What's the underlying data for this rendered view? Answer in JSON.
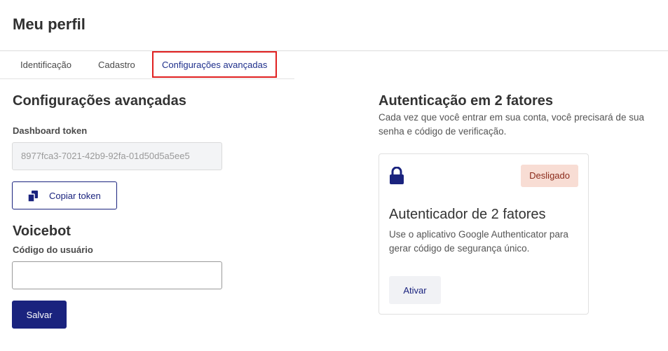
{
  "page": {
    "title": "Meu perfil"
  },
  "tabs": [
    {
      "label": "Identificação"
    },
    {
      "label": "Cadastro"
    },
    {
      "label": "Configurações avançadas",
      "active": true
    }
  ],
  "advanced": {
    "title": "Configurações avançadas",
    "token_label": "Dashboard token",
    "token_value": "8977fca3-7021-42b9-92fa-01d50d5a5ee5",
    "copy_label": "Copiar token"
  },
  "voicebot": {
    "title": "Voicebot",
    "user_code_label": "Código do usuário",
    "user_code_value": "",
    "save_label": "Salvar"
  },
  "twofa": {
    "title": "Autenticação em 2 fatores",
    "description": "Cada vez que você entrar em sua conta, você precisará de sua senha e código de verificação.",
    "card": {
      "icon": "lock-icon",
      "status": "Desligado",
      "title": "Autenticador de 2 fatores",
      "description": "Use o aplicativo Google Authenticator para gerar código de segurança único.",
      "activate_label": "Ativar"
    }
  },
  "colors": {
    "primary": "#1a237e",
    "highlight_border": "#e02020",
    "badge_bg": "#f8ddd4",
    "badge_text": "#8b2a1a"
  }
}
